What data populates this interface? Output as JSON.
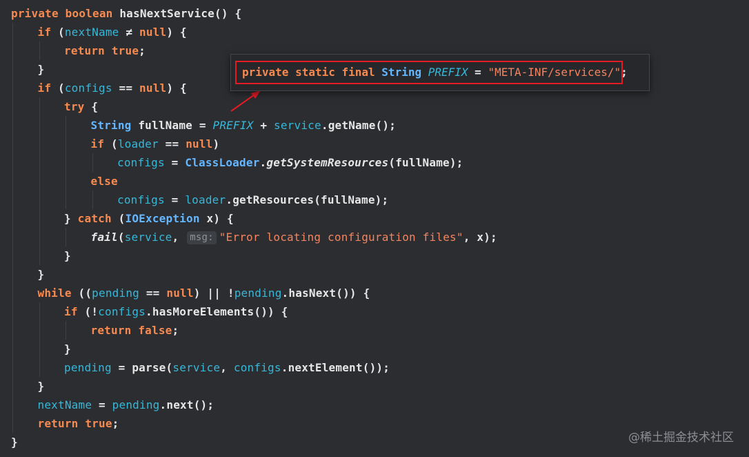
{
  "code": {
    "lines": [
      [
        [
          "kw",
          "private boolean "
        ],
        [
          "fn",
          "hasNextService"
        ],
        [
          "pln",
          "() {"
        ]
      ],
      [
        [
          "kw",
          "if "
        ],
        [
          "pln",
          "("
        ],
        [
          "fld",
          "nextName"
        ],
        [
          "pln",
          " ≠ "
        ],
        [
          "kw",
          "null"
        ],
        [
          "pln",
          ") {"
        ]
      ],
      [
        [
          "kw",
          "return true"
        ],
        [
          "pln",
          ";"
        ]
      ],
      [
        [
          "pln",
          "}"
        ]
      ],
      [
        [
          "kw",
          "if "
        ],
        [
          "pln",
          "("
        ],
        [
          "fld",
          "configs"
        ],
        [
          "pln",
          " == "
        ],
        [
          "kw",
          "null"
        ],
        [
          "pln",
          ") {"
        ]
      ],
      [
        [
          "kw",
          "try "
        ],
        [
          "pln",
          "{"
        ]
      ],
      [
        [
          "typ",
          "String "
        ],
        [
          "pln",
          "fullName = "
        ],
        [
          "con",
          "PREFIX"
        ],
        [
          "pln",
          " + "
        ],
        [
          "fld",
          "service"
        ],
        [
          "pln",
          "."
        ],
        [
          "fn",
          "getName"
        ],
        [
          "pln",
          "();"
        ]
      ],
      [
        [
          "kw",
          "if "
        ],
        [
          "pln",
          "("
        ],
        [
          "fld",
          "loader"
        ],
        [
          "pln",
          " == "
        ],
        [
          "kw",
          "null"
        ],
        [
          "pln",
          ")"
        ]
      ],
      [
        [
          "fld",
          "configs"
        ],
        [
          "pln",
          " = "
        ],
        [
          "typ",
          "ClassLoader"
        ],
        [
          "pln",
          "."
        ],
        [
          "mth",
          "getSystemResources"
        ],
        [
          "pln",
          "(fullName);"
        ]
      ],
      [
        [
          "kw",
          "else"
        ]
      ],
      [
        [
          "fld",
          "configs"
        ],
        [
          "pln",
          " = "
        ],
        [
          "fld",
          "loader"
        ],
        [
          "pln",
          "."
        ],
        [
          "fn",
          "getResources"
        ],
        [
          "pln",
          "(fullName);"
        ]
      ],
      [
        [
          "pln",
          "} "
        ],
        [
          "kw",
          "catch "
        ],
        [
          "pln",
          "("
        ],
        [
          "typ",
          "IOException"
        ],
        [
          "pln",
          " x) {"
        ]
      ],
      [
        [
          "mth",
          "fail"
        ],
        [
          "pln",
          "("
        ],
        [
          "fld",
          "service"
        ],
        [
          "pln",
          ", "
        ],
        [
          "hint",
          "msg:"
        ],
        [
          "str",
          "\"Error locating configuration files\""
        ],
        [
          "pln",
          ", x);"
        ]
      ],
      [
        [
          "pln",
          "}"
        ]
      ],
      [
        [
          "pln",
          "}"
        ]
      ],
      [
        [
          "kw",
          "while "
        ],
        [
          "pln",
          "(("
        ],
        [
          "fld",
          "pending"
        ],
        [
          "pln",
          " == "
        ],
        [
          "kw",
          "null"
        ],
        [
          "pln",
          ") || !"
        ],
        [
          "fld",
          "pending"
        ],
        [
          "pln",
          "."
        ],
        [
          "fn",
          "hasNext"
        ],
        [
          "pln",
          "()) {"
        ]
      ],
      [
        [
          "kw",
          "if "
        ],
        [
          "pln",
          "(!"
        ],
        [
          "fld",
          "configs"
        ],
        [
          "pln",
          "."
        ],
        [
          "fn",
          "hasMoreElements"
        ],
        [
          "pln",
          "()) {"
        ]
      ],
      [
        [
          "kw",
          "return false"
        ],
        [
          "pln",
          ";"
        ]
      ],
      [
        [
          "pln",
          "}"
        ]
      ],
      [
        [
          "fld",
          "pending"
        ],
        [
          "pln",
          " = "
        ],
        [
          "fn",
          "parse"
        ],
        [
          "pln",
          "("
        ],
        [
          "fld",
          "service"
        ],
        [
          "pln",
          ", "
        ],
        [
          "fld",
          "configs"
        ],
        [
          "pln",
          "."
        ],
        [
          "fn",
          "nextElement"
        ],
        [
          "pln",
          "());"
        ]
      ],
      [
        [
          "pln",
          "}"
        ]
      ],
      [
        [
          "fld",
          "nextName"
        ],
        [
          "pln",
          " = "
        ],
        [
          "fld",
          "pending"
        ],
        [
          "pln",
          "."
        ],
        [
          "fn",
          "next"
        ],
        [
          "pln",
          "();"
        ]
      ],
      [
        [
          "kw",
          "return true"
        ],
        [
          "pln",
          ";"
        ]
      ],
      [
        [
          "pln",
          "}"
        ]
      ]
    ]
  },
  "popup": {
    "tokens": [
      [
        "kw",
        "private static final "
      ],
      [
        "typ",
        "String "
      ],
      [
        "con",
        "PREFIX"
      ],
      [
        "pln",
        " = "
      ],
      [
        "str",
        "\"META-INF/services/\""
      ],
      [
        "pln",
        ";"
      ]
    ],
    "highlight_color": "#e51b23"
  },
  "watermark": "@稀土掘金技术社区"
}
